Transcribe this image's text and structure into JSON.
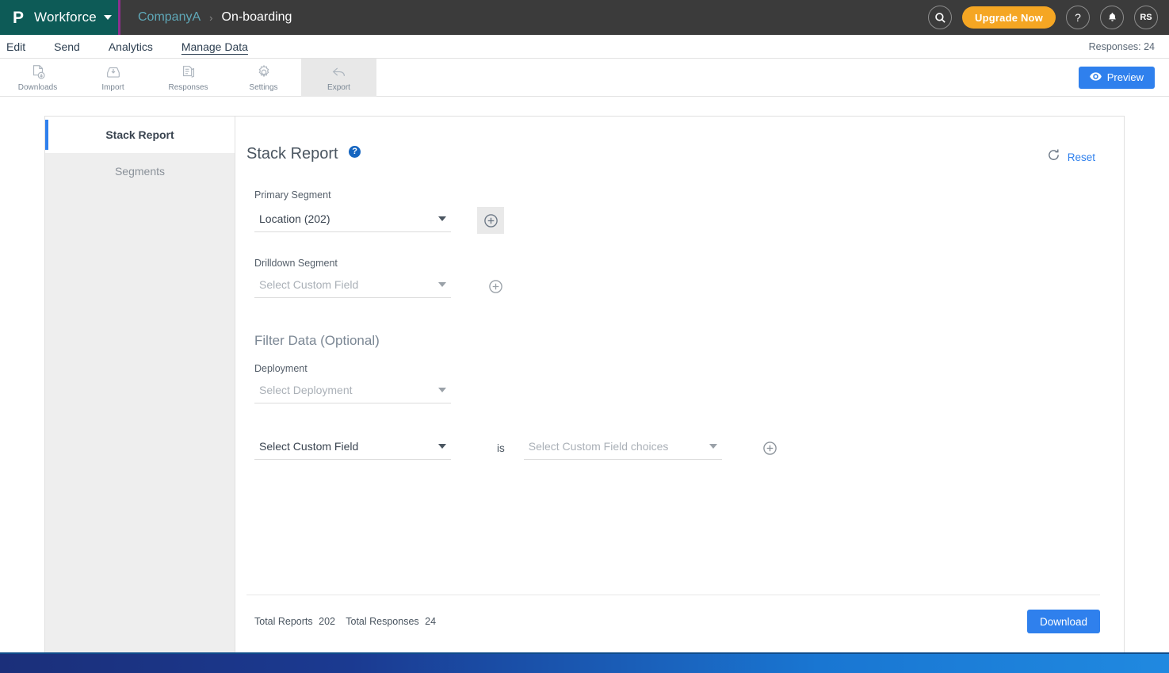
{
  "topbar": {
    "product_name": "Workforce",
    "logo_mark": "proprofs-logo-icon",
    "breadcrumb": {
      "company": "CompanyA",
      "separator": "›",
      "current": "On-boarding"
    },
    "search_icon": "search-icon",
    "upgrade_label": "Upgrade Now",
    "help_icon": "question-mark-icon",
    "bell_icon": "bell-icon",
    "avatar_initials": "RS",
    "bg_color": "#3b3b3b",
    "logo_bg_color": "#0d5b57",
    "upgrade_color": "#f5a623"
  },
  "nav": {
    "items": [
      {
        "label": "Edit",
        "active": false
      },
      {
        "label": "Send",
        "active": false
      },
      {
        "label": "Analytics",
        "active": false
      },
      {
        "label": "Manage Data",
        "active": true
      }
    ],
    "responses_count": "Responses: 24"
  },
  "toolbar": {
    "items": [
      {
        "label": "Downloads",
        "icon": "document-download-icon",
        "active": false
      },
      {
        "label": "Import",
        "icon": "import-tray-icon",
        "active": false
      },
      {
        "label": "Responses",
        "icon": "responses-document-icon",
        "active": false
      },
      {
        "label": "Settings",
        "icon": "gear-icon",
        "active": false
      },
      {
        "label": "Export",
        "icon": "export-arrow-icon",
        "active": true
      }
    ],
    "preview_label": "Preview",
    "preview_icon": "eye-icon",
    "preview_color": "#2f80ed"
  },
  "sidebar": {
    "items": [
      {
        "label": "Stack Report",
        "active": true
      },
      {
        "label": "Segments",
        "active": false
      }
    ],
    "accent_color": "#2f80ed"
  },
  "main": {
    "title": "Stack Report",
    "help_icon": "help-circle-icon",
    "reset": {
      "label": "Reset",
      "icon": "refresh-icon",
      "color": "#2f80ed"
    },
    "primary_segment": {
      "label": "Primary Segment",
      "value": "Location (202)",
      "add_icon": "plus-circle-icon"
    },
    "drilldown_segment": {
      "label": "Drilldown Segment",
      "placeholder": "Select Custom Field",
      "add_icon": "plus-circle-icon"
    },
    "filter_section": {
      "title": "Filter Data (Optional)",
      "deployment_label": "Deployment",
      "deployment_placeholder": "Select Deployment",
      "custom_field_placeholder": "Select Custom Field",
      "is_label": "is",
      "choices_placeholder": "Select Custom Field choices",
      "add_icon": "plus-circle-icon"
    },
    "footer": {
      "total_reports_label": "Total Reports",
      "total_reports_value": "202",
      "total_responses_label": "Total Responses",
      "total_responses_value": "24",
      "download_label": "Download",
      "download_color": "#2f80ed"
    }
  }
}
